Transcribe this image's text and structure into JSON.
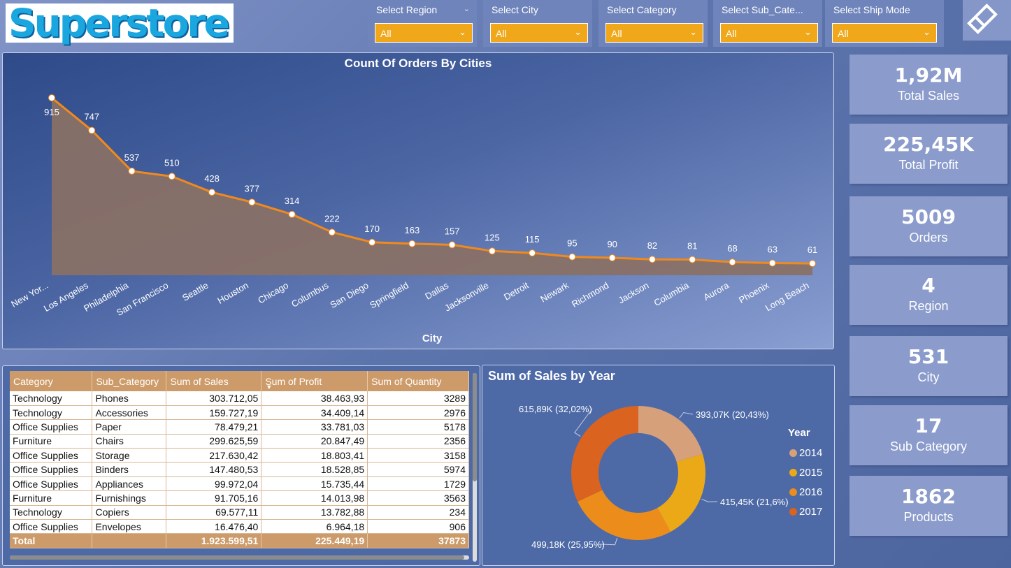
{
  "logo": {
    "text": "Superstore"
  },
  "slicers": [
    {
      "title": "Select Region",
      "value": "All"
    },
    {
      "title": "Select City",
      "value": "All"
    },
    {
      "title": "Select Category",
      "value": "All"
    },
    {
      "title": "Select Sub_Cate...",
      "value": "All"
    },
    {
      "title": "Select Ship Mode",
      "value": "All"
    }
  ],
  "kpis": [
    {
      "value": "1,92M",
      "label": "Total Sales"
    },
    {
      "value": "225,45K",
      "label": "Total Profit"
    },
    {
      "value": "5009",
      "label": "Orders"
    },
    {
      "value": "4",
      "label": "Region"
    },
    {
      "value": "531",
      "label": "City"
    },
    {
      "value": "17",
      "label": "Sub Category"
    },
    {
      "value": "1862",
      "label": "Products"
    }
  ],
  "line_chart_title": "Count Of Orders By Cities",
  "pie_chart_title": "Sum of Sales by Year",
  "table": {
    "columns": [
      "Category",
      "Sub_Category",
      "Sum of Sales",
      "Sum of Profit",
      "Sum of Quantity"
    ],
    "rows": [
      [
        "Technology",
        "Phones",
        "303.712,05",
        "38.463,93",
        "3289"
      ],
      [
        "Technology",
        "Accessories",
        "159.727,19",
        "34.409,14",
        "2976"
      ],
      [
        "Office Supplies",
        "Paper",
        "78.479,21",
        "33.781,03",
        "5178"
      ],
      [
        "Furniture",
        "Chairs",
        "299.625,59",
        "20.847,49",
        "2356"
      ],
      [
        "Office Supplies",
        "Storage",
        "217.630,42",
        "18.803,41",
        "3158"
      ],
      [
        "Office Supplies",
        "Binders",
        "147.480,53",
        "18.528,85",
        "5974"
      ],
      [
        "Office Supplies",
        "Appliances",
        "99.972,04",
        "15.735,44",
        "1729"
      ],
      [
        "Furniture",
        "Furnishings",
        "91.705,16",
        "14.013,98",
        "3563"
      ],
      [
        "Technology",
        "Copiers",
        "69.577,11",
        "13.782,88",
        "234"
      ],
      [
        "Office Supplies",
        "Envelopes",
        "16.476,40",
        "6.964,18",
        "906"
      ]
    ],
    "total": [
      "Total",
      "",
      "1.923.599,51",
      "225.449,19",
      "37873"
    ]
  },
  "chart_data": [
    {
      "type": "area",
      "title": "Count Of Orders By Cities",
      "xlabel": "City",
      "ylabel": "",
      "categories": [
        "New Yor...",
        "Los Angeles",
        "Philadelphia",
        "San Francisco",
        "Seattle",
        "Houston",
        "Chicago",
        "Columbus",
        "San Diego",
        "Springfield",
        "Dallas",
        "Jacksonville",
        "Detroit",
        "Newark",
        "Richmond",
        "Jackson",
        "Columbia",
        "Aurora",
        "Phoenix",
        "Long Beach"
      ],
      "values": [
        915,
        747,
        537,
        510,
        428,
        377,
        314,
        222,
        170,
        163,
        157,
        125,
        115,
        95,
        90,
        82,
        81,
        68,
        63,
        61
      ],
      "ylim": [
        0,
        915
      ],
      "line_color": "#f18a1c",
      "fill_color": "#8a7065"
    },
    {
      "type": "pie",
      "title": "Sum of Sales by Year",
      "legend_title": "Year",
      "legend_position": "right",
      "slices": [
        {
          "name": "2014",
          "value": 393.07,
          "label": "393,07K (20,43%)",
          "color": "#d6a07a"
        },
        {
          "name": "2015",
          "value": 415.45,
          "label": "415,45K (21,6%)",
          "color": "#eba918"
        },
        {
          "name": "2016",
          "value": 499.18,
          "label": "499,18K (25,95%)",
          "color": "#ec8d1b"
        },
        {
          "name": "2017",
          "value": 615.89,
          "label": "615,89K (32,02%)",
          "color": "#d9631f"
        }
      ]
    }
  ]
}
